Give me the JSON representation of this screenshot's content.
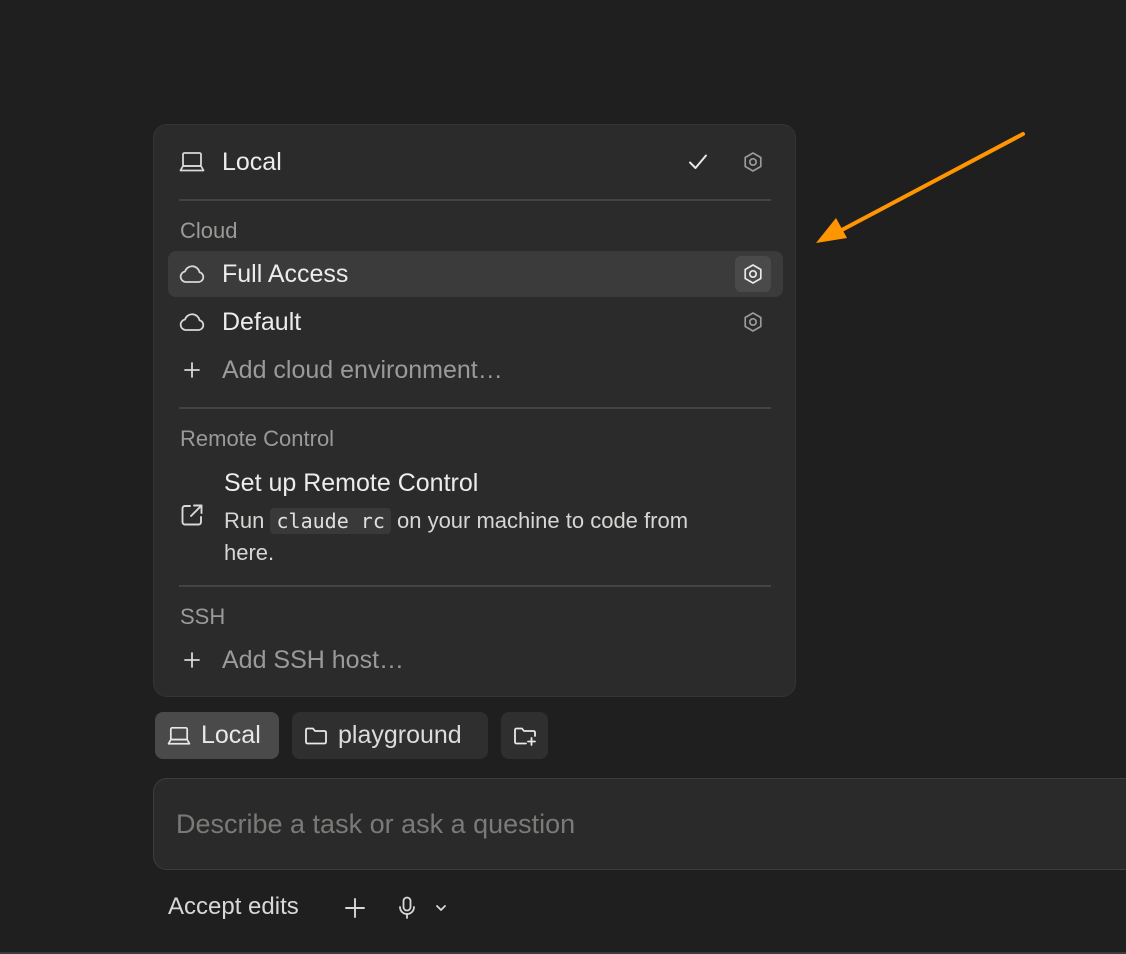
{
  "environment_menu": {
    "local": {
      "label": "Local",
      "selected": true
    },
    "cloud": {
      "section_label": "Cloud",
      "items": [
        {
          "label": "Full Access",
          "highlighted": true
        },
        {
          "label": "Default",
          "highlighted": false
        }
      ],
      "add_label": "Add cloud environment…"
    },
    "remote_control": {
      "section_label": "Remote Control",
      "title": "Set up Remote Control",
      "desc_before": "Run",
      "command": "claude rc",
      "desc_after": "on your machine to code from here."
    },
    "ssh": {
      "section_label": "SSH",
      "add_label": "Add SSH host…"
    }
  },
  "chips": {
    "environment_label": "Local",
    "folder_label": "playground"
  },
  "composer": {
    "placeholder": "Describe a task or ask a question",
    "mode_label": "Accept edits"
  },
  "colors": {
    "annotation_arrow": "#ff9500",
    "background": "#1f1f1f",
    "panel": "#2b2b2b"
  }
}
